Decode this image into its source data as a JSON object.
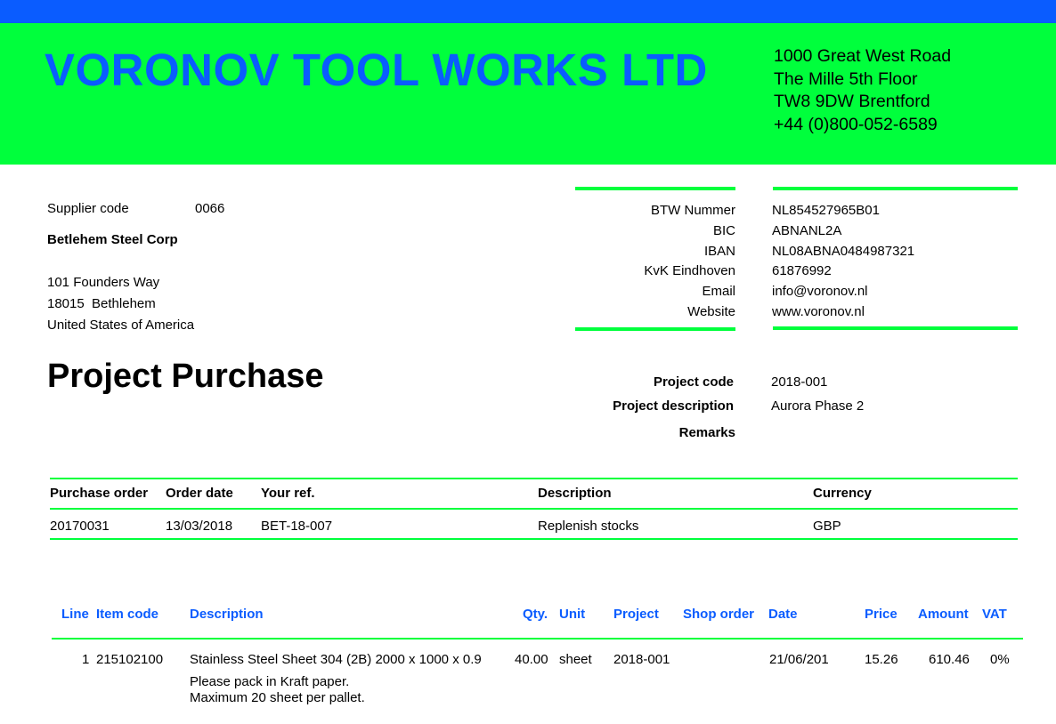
{
  "company": {
    "name": "VORONOV TOOL WORKS LTD",
    "address_lines": [
      "1000 Great West Road",
      "The Mille 5th Floor",
      "TW8 9DW Brentford",
      "+44 (0)800-052-6589"
    ]
  },
  "supplier": {
    "code_label": "Supplier code",
    "code": "0066",
    "name": "Betlehem Steel Corp",
    "address_lines": [
      "101 Founders Way",
      "18015  Bethlehem",
      "United States of America"
    ]
  },
  "bank": {
    "labels": [
      "BTW Nummer",
      "BIC",
      "IBAN",
      "KvK Eindhoven",
      "Email",
      "Website"
    ],
    "values": [
      "NL854527965B01",
      "ABNANL2A",
      "NL08ABNA0484987321",
      "61876992",
      "info@voronov.nl",
      "www.voronov.nl"
    ]
  },
  "document_title": "Project Purchase",
  "project": {
    "code_label": "Project code",
    "code": "2018-001",
    "description_label": "Project description",
    "description": "Aurora Phase 2",
    "remarks_label": "Remarks",
    "remarks": ""
  },
  "order_table": {
    "headers": [
      "Purchase order",
      "Order date",
      "Your ref.",
      "Description",
      "Currency"
    ],
    "row": [
      "20170031",
      "13/03/2018",
      "BET-18-007",
      "Replenish stocks",
      "GBP"
    ]
  },
  "lines_table": {
    "headers": {
      "line": "Line",
      "item_code": "Item code",
      "description": "Description",
      "qty": "Qty.",
      "unit": "Unit",
      "project": "Project",
      "shop_order": "Shop order",
      "date": "Date",
      "price": "Price",
      "amount": "Amount",
      "vat": "VAT"
    },
    "rows": [
      {
        "line": "1",
        "item_code": "215102100",
        "description": "Stainless Steel Sheet 304 (2B) 2000 x 1000 x 0.9",
        "qty": "40.00",
        "unit": "sheet",
        "project": "2018-001",
        "shop_order": "",
        "date": "21/06/201",
        "price": "15.26",
        "amount": "610.46",
        "vat": "0%",
        "notes": [
          "Please pack in Kraft paper.",
          "Maximum 20 sheet per pallet."
        ]
      }
    ]
  },
  "colors": {
    "brand_blue": "#0a5cff",
    "brand_green": "#00ff3c"
  }
}
